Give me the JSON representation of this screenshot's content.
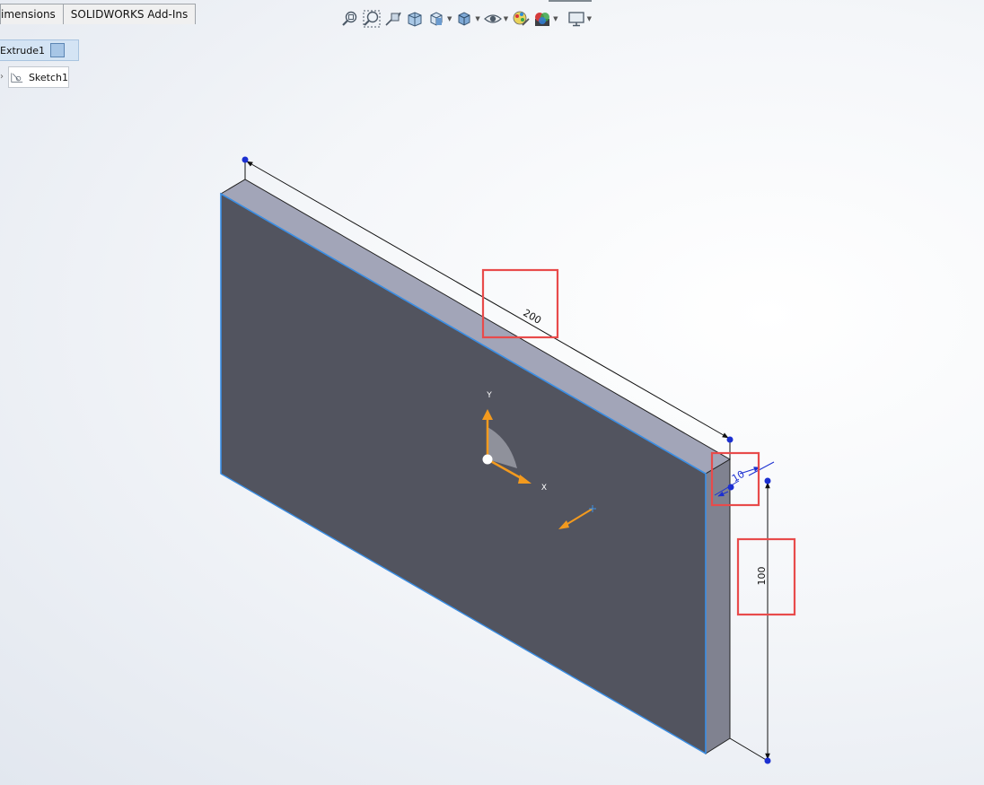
{
  "tabs": [
    {
      "label": "imensions"
    },
    {
      "label": "SOLIDWORKS Add-Ins"
    }
  ],
  "heads_up_toolbar": [
    {
      "icon": "zoom-to-fit-icon",
      "has_dropdown": false
    },
    {
      "icon": "zoom-to-area-icon",
      "has_dropdown": false
    },
    {
      "icon": "previous-view-icon",
      "has_dropdown": false
    },
    {
      "icon": "section-view-icon",
      "has_dropdown": false
    },
    {
      "icon": "view-orientation-icon",
      "has_dropdown": true
    },
    {
      "icon": "display-style-icon",
      "has_dropdown": true
    },
    {
      "icon": "hide-show-items-icon",
      "has_dropdown": true
    },
    {
      "icon": "edit-appearance-icon",
      "has_dropdown": false
    },
    {
      "icon": "apply-scene-icon",
      "has_dropdown": true
    },
    {
      "icon": "view-settings-icon",
      "has_dropdown": true
    }
  ],
  "feature_tree": {
    "feature": {
      "label": "Extrude1",
      "icon": "extrude-feature-icon"
    },
    "sketch": {
      "label": "Sketch1",
      "icon": "sketch-icon"
    }
  },
  "dimensions": {
    "length": "200",
    "thickness": "10",
    "height": "100"
  },
  "triad": {
    "x_label": "X",
    "y_label": "Y"
  },
  "colors": {
    "front_face": "#52545f",
    "top_face": "#a2a5b8",
    "side_face": "#808290",
    "edge_highlight": "#3a8fe6",
    "dimension_point": "#1b2fd1",
    "callout": "#e84b4b",
    "triad_arrow": "#f39a1e"
  }
}
